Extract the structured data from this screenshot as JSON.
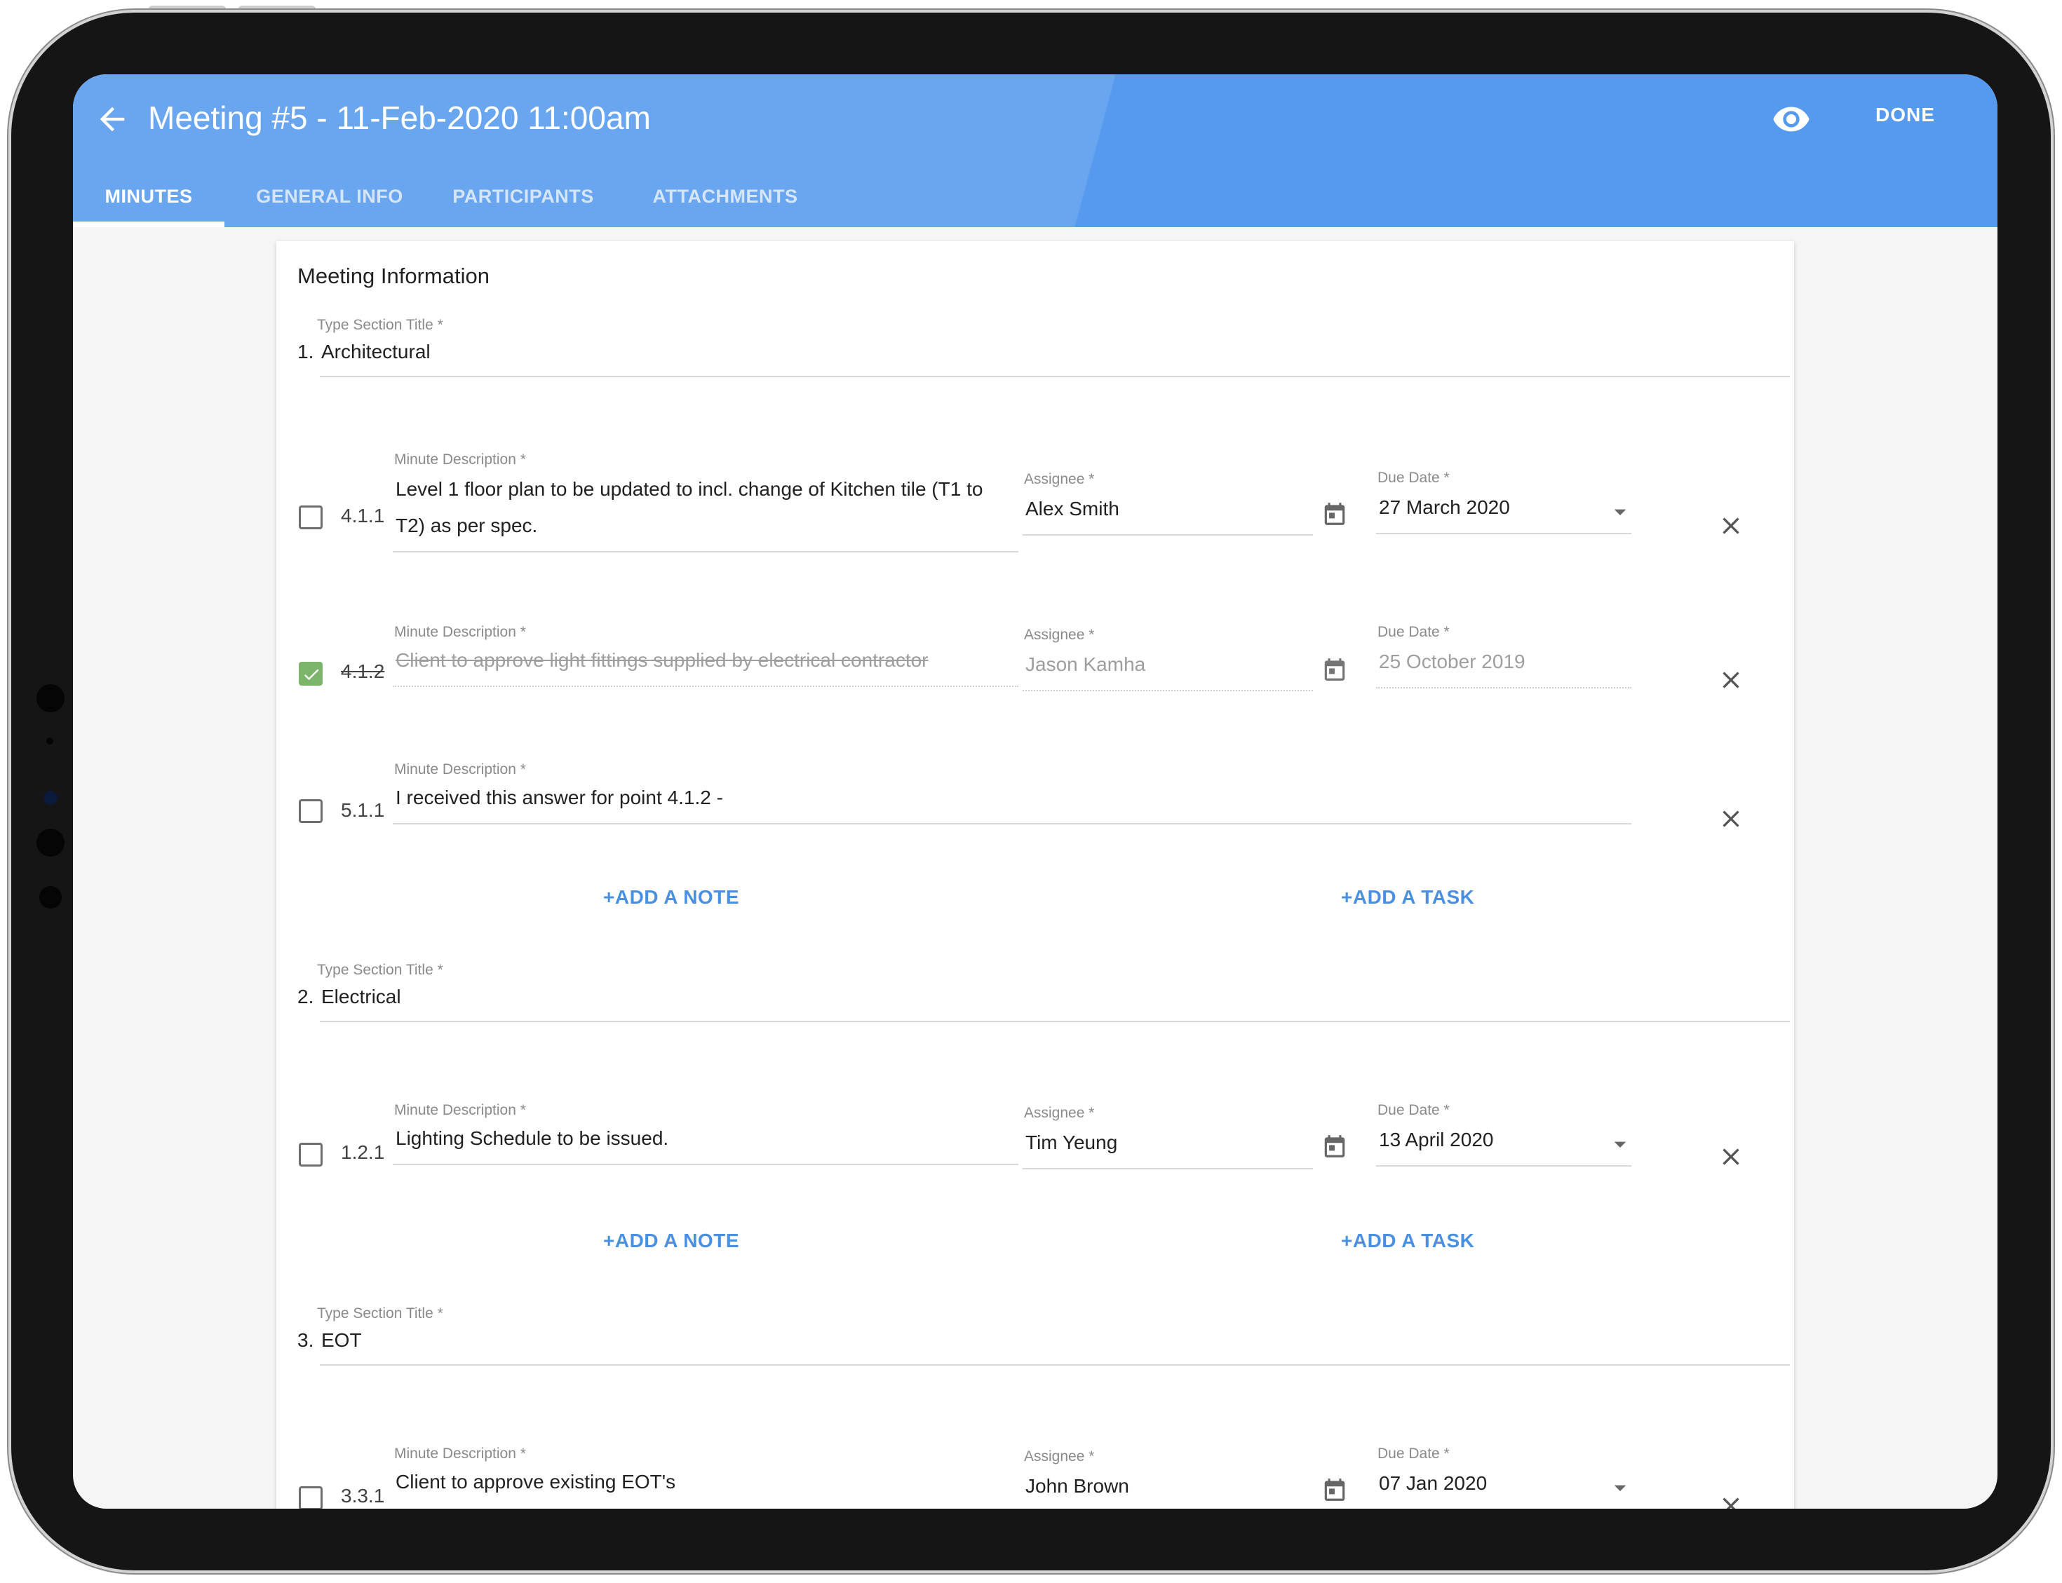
{
  "header": {
    "title": "Meeting #5 - 11-Feb-2020 11:00am",
    "done_label": "DONE",
    "back_icon": "arrow-left-icon",
    "preview_icon": "eye-icon"
  },
  "tabs": [
    {
      "label": "MINUTES",
      "active": true
    },
    {
      "label": "GENERAL INFO",
      "active": false
    },
    {
      "label": "PARTICIPANTS",
      "active": false
    },
    {
      "label": "ATTACHMENTS",
      "active": false
    }
  ],
  "colors": {
    "appbar": "#6aa6ef",
    "appbar_dark": "#559aee",
    "accent": "#4a90e2",
    "checked": "#7cb56a"
  },
  "card": {
    "title": "Meeting Information"
  },
  "labels": {
    "section_title": "Type Section Title *",
    "minute_description": "Minute Description *",
    "assignee": "Assignee *",
    "due_date": "Due Date *"
  },
  "actions": {
    "add_note": "+ADD A NOTE",
    "add_task": "+ADD A TASK"
  },
  "sections": [
    {
      "title": "Architectural",
      "number": "1.",
      "minutes": [
        {
          "id": "4.1.1",
          "description_line1": "Level 1 floor plan to be updated to incl. change of Kitchen tile (T1 to",
          "description_line2": "T2) as per spec.",
          "assignee": "Alex Smith",
          "due_date": "27 March 2020",
          "completed": false
        },
        {
          "id": "4.1.2",
          "description": "Client to approve light fittings supplied by electrical contractor",
          "assignee": "Jason Kamha",
          "due_date": "25 October 2019",
          "completed": true
        },
        {
          "id": "5.1.1",
          "description": "I received this answer for point 4.1.2 -",
          "completed": false
        }
      ]
    },
    {
      "title": "Electrical",
      "number": "2.",
      "minutes": [
        {
          "id": "1.2.1",
          "description": "Lighting Schedule to be issued.",
          "assignee": "Tim Yeung",
          "due_date": "13 April 2020",
          "completed": false
        }
      ]
    },
    {
      "title": "EOT",
      "number": "3.",
      "minutes": [
        {
          "id": "3.3.1",
          "description": "Client to approve existing EOT's",
          "assignee": "John Brown",
          "due_date": "07 Jan 2020",
          "completed": false
        }
      ]
    }
  ]
}
